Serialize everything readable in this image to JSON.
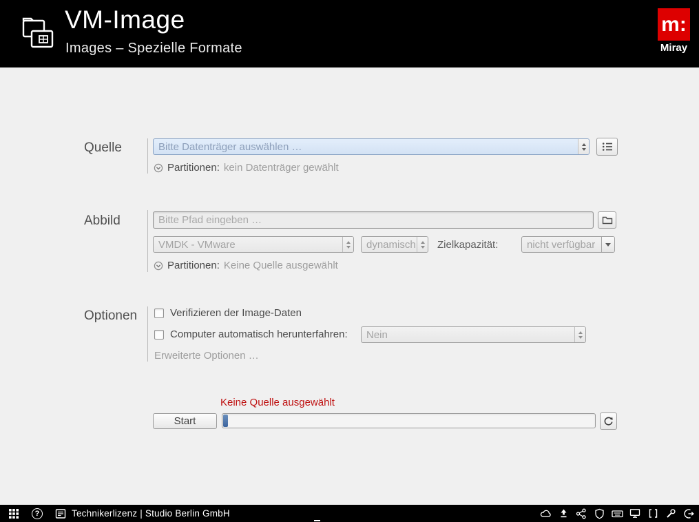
{
  "header": {
    "title": "VM-Image",
    "subtitle": "Images – Spezielle Formate",
    "logo": {
      "mark": "m:",
      "brand": "Miray"
    }
  },
  "sections": {
    "quelle": {
      "label": "Quelle",
      "source_placeholder": "Bitte Datenträger auswählen …",
      "partitions_label": "Partitionen:",
      "partitions_value": "kein Datenträger gewählt"
    },
    "abbild": {
      "label": "Abbild",
      "path_placeholder": "Bitte Pfad eingeben …",
      "format_value": "VMDK - VMware",
      "allocation_value": "dynamisch",
      "capacity_label": "Zielkapazität:",
      "capacity_value": "nicht verfügbar",
      "partitions_label": "Partitionen:",
      "partitions_value": "Keine Quelle ausgewählt"
    },
    "optionen": {
      "label": "Optionen",
      "verify_label": "Verifizieren der Image-Daten",
      "verify_checked": false,
      "shutdown_label": "Computer automatisch herunterfahren:",
      "shutdown_checked": false,
      "shutdown_value": "Nein",
      "advanced_label": "Erweiterte Optionen …"
    }
  },
  "action": {
    "status_message": "Keine Quelle ausgewählt",
    "start_label": "Start"
  },
  "footer": {
    "license_text": "Technikerlizenz | Studio Berlin GmbH",
    "help_glyph": "?"
  },
  "colors": {
    "accent_blue": "#3c649e",
    "status_red": "#bf1212",
    "source_field_blue": "#d9e6f5",
    "brand_red": "#dd0000"
  }
}
